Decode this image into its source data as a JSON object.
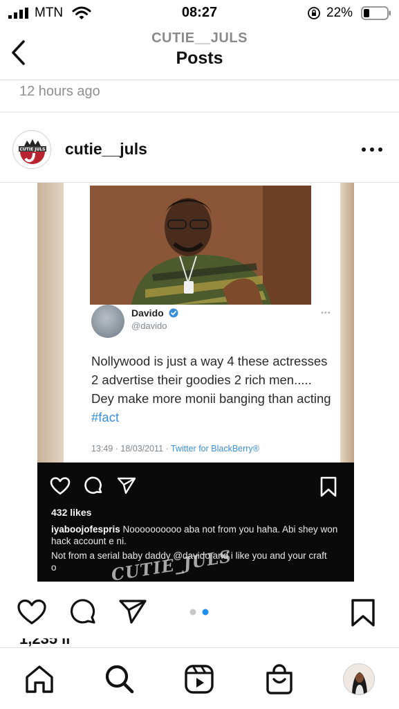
{
  "status_bar": {
    "carrier": "MTN",
    "time": "08:27",
    "battery_percent": "22%",
    "icons": [
      "signal-icon",
      "wifi-icon",
      "orientation-lock-icon",
      "battery-icon"
    ]
  },
  "header": {
    "username": "CUTIE__JULS",
    "title": "Posts",
    "back_icon": "chevron-left-icon"
  },
  "post": {
    "timestamp": "12 hours ago",
    "author": "cutie__juls",
    "more_icon": "more-horizontal-icon",
    "avatar_text": "CUTIE JULS",
    "carousel": {
      "count": 2,
      "active": 2
    },
    "likes_peek": "1,235 li"
  },
  "embedded": {
    "tweet": {
      "name": "Davido",
      "handle": "@davido",
      "text": "Nollywood is just a way 4 these actresses 2 advertise their goodies 2 rich men..... Dey make more monii banging than acting ",
      "hashtag": "#fact",
      "meta": "13:49 · 18/03/2011 · ",
      "source": "Twitter for BlackBerry®"
    },
    "likes": "432 likes",
    "comment_user": "iyaboojofespris",
    "comment_text": " Noooooooooo aba not from you haha. Abi shey won hack account e ni.",
    "comment2_text": "Not from a serial baby daddy @davido and i like you and your craft o",
    "watermark": "CUTIE_JULS"
  },
  "actions": {
    "icons": [
      "heart-icon",
      "comment-icon",
      "send-icon",
      "bookmark-icon"
    ]
  },
  "bottom_nav": {
    "items": [
      "home-icon",
      "search-icon",
      "reels-icon",
      "shop-icon",
      "profile-avatar"
    ]
  },
  "colors": {
    "link_blue": "#3a8fd9",
    "carousel_active": "#1e8ef0",
    "carousel_inactive": "#c8c8c8",
    "muted_text": "#8e8e8e"
  }
}
